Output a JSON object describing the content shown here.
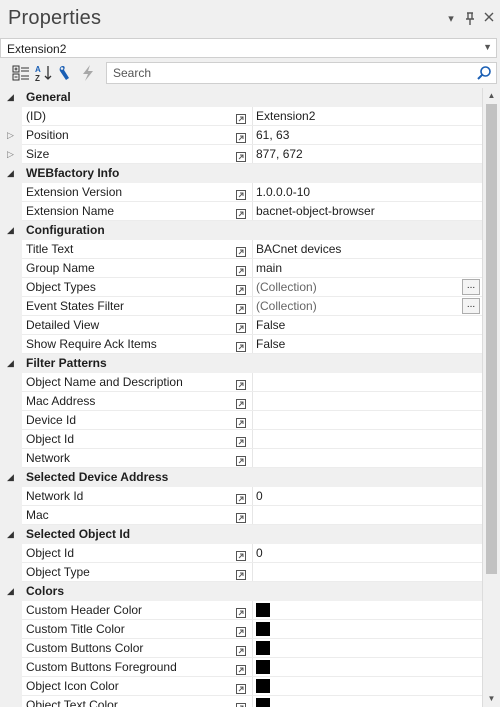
{
  "panel": {
    "title": "Properties",
    "object_selector": "Extension2",
    "search_placeholder": "Search"
  },
  "categories": [
    {
      "name": "General",
      "rows": [
        {
          "name": "(ID)",
          "value": "Extension2"
        },
        {
          "name": "Position",
          "value": "61, 63",
          "expandable": true
        },
        {
          "name": "Size",
          "value": "877, 672",
          "expandable": true
        }
      ]
    },
    {
      "name": "WEBfactory Info",
      "rows": [
        {
          "name": "Extension Version",
          "value": "1.0.0.0-10"
        },
        {
          "name": "Extension Name",
          "value": "bacnet-object-browser"
        }
      ]
    },
    {
      "name": "Configuration",
      "rows": [
        {
          "name": "Title Text",
          "value": "BACnet devices"
        },
        {
          "name": "Group Name",
          "value": "main"
        },
        {
          "name": "Object Types",
          "value": "(Collection)",
          "button": "...",
          "gray": true
        },
        {
          "name": "Event States Filter",
          "value": "(Collection)",
          "button": "...",
          "gray": true
        },
        {
          "name": "Detailed View",
          "value": "False"
        },
        {
          "name": "Show Require Ack Items",
          "value": "False"
        }
      ]
    },
    {
      "name": "Filter Patterns",
      "rows": [
        {
          "name": "Object Name and Description",
          "value": ""
        },
        {
          "name": "Mac Address",
          "value": ""
        },
        {
          "name": "Device Id",
          "value": ""
        },
        {
          "name": "Object Id",
          "value": ""
        },
        {
          "name": "Network",
          "value": ""
        }
      ]
    },
    {
      "name": "Selected Device Address",
      "rows": [
        {
          "name": "Network Id",
          "value": "0"
        },
        {
          "name": "Mac",
          "value": ""
        }
      ]
    },
    {
      "name": "Selected Object Id",
      "rows": [
        {
          "name": "Object Id",
          "value": "0"
        },
        {
          "name": "Object Type",
          "value": ""
        }
      ]
    },
    {
      "name": "Colors",
      "rows": [
        {
          "name": "Custom Header Color",
          "color": "#000000"
        },
        {
          "name": "Custom Title Color",
          "color": "#000000"
        },
        {
          "name": "Custom Buttons Color",
          "color": "#000000"
        },
        {
          "name": "Custom Buttons Foreground",
          "color": "#000000"
        },
        {
          "name": "Object Icon Color",
          "color": "#000000"
        },
        {
          "name": "Object Text Color",
          "color": "#000000"
        }
      ]
    }
  ]
}
